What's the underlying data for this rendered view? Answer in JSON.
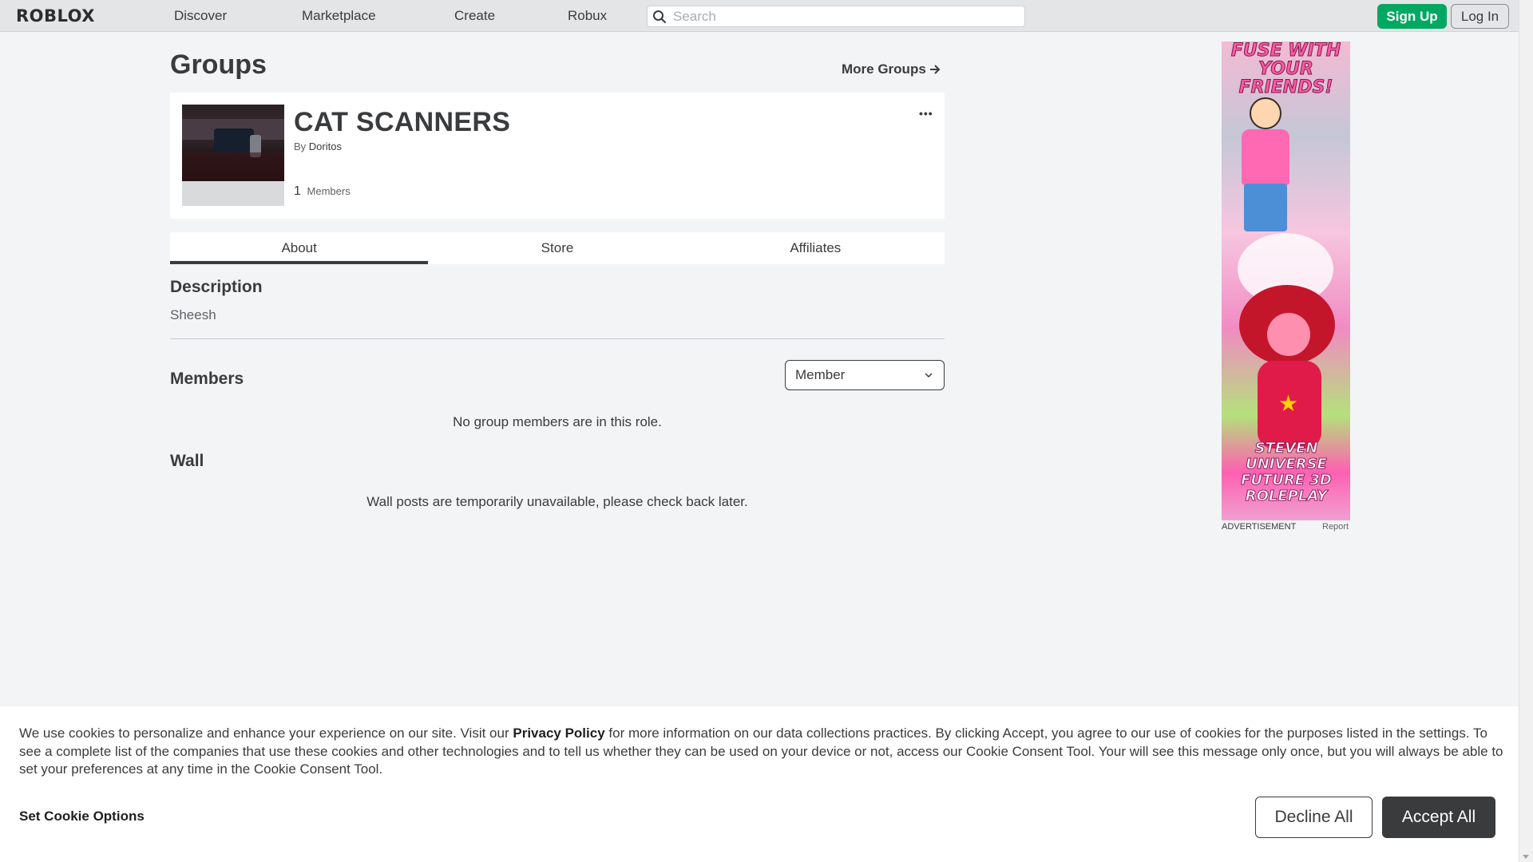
{
  "header": {
    "logo": "ROBLOX",
    "nav": [
      "Discover",
      "Marketplace",
      "Create",
      "Robux"
    ],
    "search_placeholder": "Search",
    "signup_label": "Sign Up",
    "login_label": "Log In"
  },
  "page": {
    "title": "Groups",
    "more_groups_label": "More Groups"
  },
  "group": {
    "name": "CAT SCANNERS",
    "by_label": "By",
    "owner": "Doritos",
    "member_count": "1",
    "members_label": "Members",
    "more_dots": "•••"
  },
  "tabs": [
    {
      "label": "About",
      "active": true
    },
    {
      "label": "Store",
      "active": false
    },
    {
      "label": "Affiliates",
      "active": false
    }
  ],
  "about": {
    "description_heading": "Description",
    "description_text": "Sheesh",
    "members_heading": "Members",
    "role_selected": "Member",
    "no_members_text": "No group members are in this role.",
    "wall_heading": "Wall",
    "wall_text": "Wall posts are temporarily unavailable, please check back later."
  },
  "ad": {
    "headline": "FUSE WITH YOUR FRIENDS!",
    "title": "STEVEN UNIVERSE FUTURE 3D ROLEPLAY",
    "label": "ADVERTISEMENT",
    "report_label": "Report"
  },
  "cookie": {
    "text_pre": "We use cookies to personalize and enhance your experience on our site. Visit our ",
    "privacy_link": "Privacy Policy",
    "text_post": " for more information on our data collections practices. By clicking Accept, you agree to our use of cookies for the purposes listed in the settings. To see a complete list of the companies that use these cookies and other technologies and to tell us whether they can be used on your device or not, access our Cookie Consent Tool. Your will see this message only once, but you will always be able to set your preferences at any time in the Cookie Consent Tool.",
    "options_label": "Set Cookie Options",
    "decline_label": "Decline All",
    "accept_label": "Accept All"
  },
  "colors": {
    "signup_green": "#00a862",
    "page_bg": "#f2f4f5",
    "text": "#393b3d"
  }
}
